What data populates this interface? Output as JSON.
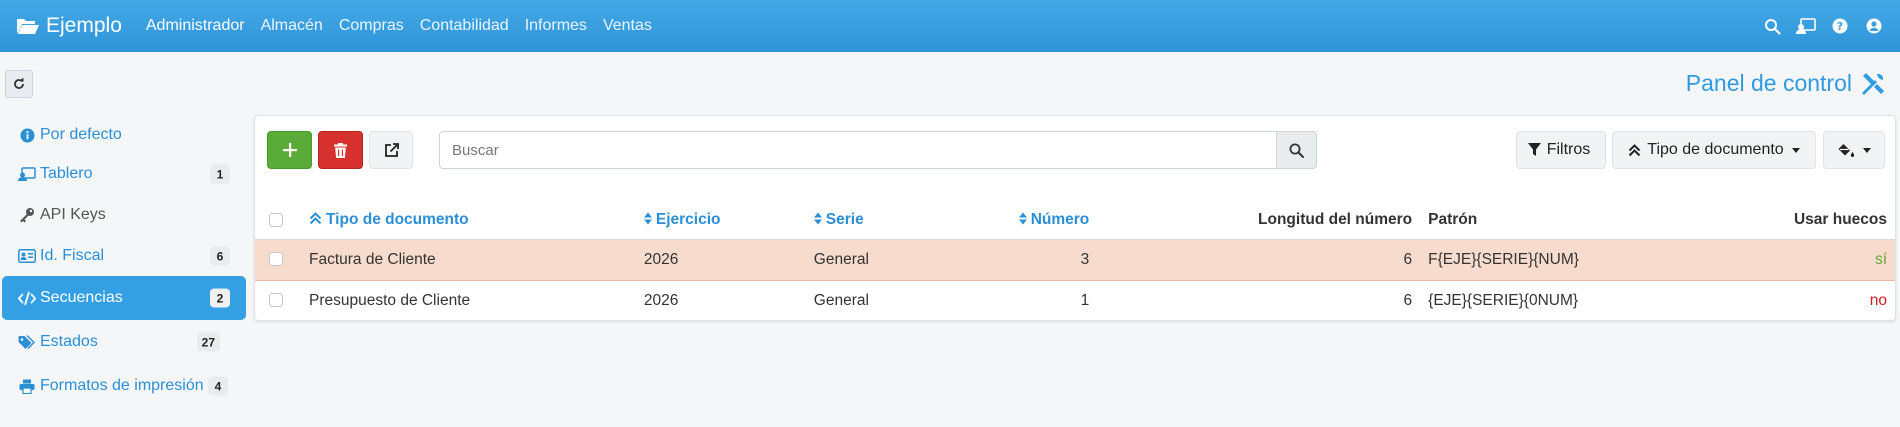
{
  "app": {
    "brand": "Ejemplo"
  },
  "nav": {
    "items": [
      "Administrador",
      "Almacén",
      "Compras",
      "Contabilidad",
      "Informes",
      "Ventas"
    ]
  },
  "topbar_icons": [
    "search-icon",
    "user-display-icon",
    "help-icon",
    "user-circle-icon"
  ],
  "page": {
    "title": "Panel de control"
  },
  "sidebar": {
    "items": [
      {
        "label": "Por defecto",
        "icon": "info-icon",
        "badge": ""
      },
      {
        "label": "Tablero",
        "icon": "id-display-icon",
        "badge": "1"
      },
      {
        "label": "API Keys",
        "icon": "key-icon",
        "badge": ""
      },
      {
        "label": "Id. Fiscal",
        "icon": "id-card-icon",
        "badge": "6"
      },
      {
        "label": "Secuencias",
        "icon": "code-icon",
        "badge": "2"
      },
      {
        "label": "Estados",
        "icon": "tags-icon",
        "badge": "27"
      },
      {
        "label": "Formatos de impresión",
        "icon": "print-icon",
        "badge": "4"
      }
    ]
  },
  "toolbar": {
    "search_placeholder": "Buscar",
    "filters_label": "Filtros",
    "order_label": "Tipo de documento"
  },
  "table": {
    "columns": [
      "Tipo de documento",
      "Ejercicio",
      "Serie",
      "Número",
      "Longitud del número",
      "Patrón",
      "Usar huecos"
    ],
    "rows": [
      {
        "tipo": "Factura de Cliente",
        "ejercicio": "2026",
        "serie": "General",
        "numero": "3",
        "longitud": "6",
        "patron": "F{EJE}{SERIE}{NUM}",
        "huecos": "sí"
      },
      {
        "tipo": "Presupuesto de Cliente",
        "ejercicio": "2026",
        "serie": "General",
        "numero": "1",
        "longitud": "6",
        "patron": "{EJE}{SERIE}{0NUM}",
        "huecos": "no"
      }
    ]
  },
  "colors": {
    "navbar": "#3aa0e0",
    "accent": "#2b8fd6",
    "add": "#5aab38",
    "delete": "#d6302f",
    "highlight_row": "#f7dccd",
    "yes": "#6aa33a",
    "no": "#d01f1f"
  }
}
